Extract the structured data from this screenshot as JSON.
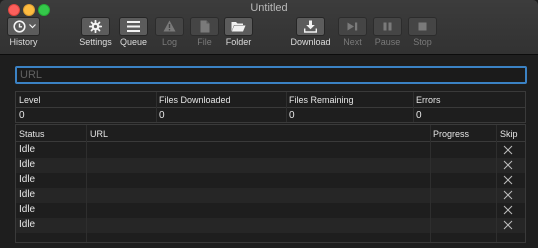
{
  "window": {
    "title": "Untitled"
  },
  "toolbar": {
    "history": "History",
    "settings": "Settings",
    "queue": "Queue",
    "log": "Log",
    "file": "File",
    "folder": "Folder",
    "download": "Download",
    "next": "Next",
    "pause": "Pause",
    "stop": "Stop"
  },
  "url": {
    "placeholder": "URL",
    "value": ""
  },
  "stats": {
    "headers": [
      "Level",
      "Files Downloaded",
      "Files Remaining",
      "Errors"
    ],
    "values": [
      "0",
      "0",
      "0",
      "0"
    ]
  },
  "queue": {
    "columns": [
      "Status",
      "URL",
      "Progress",
      "Skip"
    ],
    "rows": [
      {
        "status": "Idle"
      },
      {
        "status": "Idle"
      },
      {
        "status": "Idle"
      },
      {
        "status": "Idle"
      },
      {
        "status": "Idle"
      },
      {
        "status": "Idle"
      }
    ]
  },
  "colors": {
    "focus_ring": "#3b82c4",
    "close": "#fc605c",
    "minimize": "#fdbc40",
    "zoom": "#34c84a"
  },
  "icons": {
    "history": "clock-icon",
    "settings": "gear-icon",
    "queue": "list-icon",
    "log": "warning-icon",
    "file": "document-icon",
    "folder": "folder-icon",
    "download": "download-icon",
    "next": "skip-forward-icon",
    "pause": "pause-icon",
    "stop": "stop-icon",
    "skip": "x-icon"
  }
}
